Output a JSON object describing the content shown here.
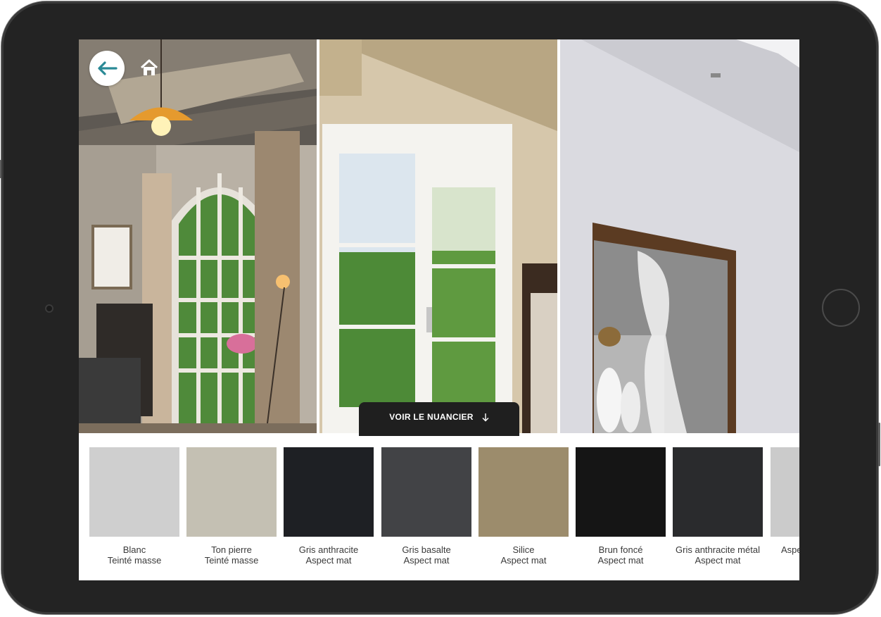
{
  "nav": {
    "back_icon": "arrow-left-icon",
    "home_icon": "home-icon",
    "accent": "#2a8a96"
  },
  "cta": {
    "label": "VOIR LE NUANCIER",
    "icon": "arrow-down-icon"
  },
  "swatches": [
    {
      "name": "Blanc",
      "finish": "Teinté masse",
      "color": "#cfcfcf"
    },
    {
      "name": "Ton pierre",
      "finish": "Teinté masse",
      "color": "#c4c0b3"
    },
    {
      "name": "Gris anthracite",
      "finish": "Aspect mat",
      "color": "#1e2024"
    },
    {
      "name": "Gris basalte",
      "finish": "Aspect mat",
      "color": "#424346"
    },
    {
      "name": "Silice",
      "finish": "Aspect mat",
      "color": "#9c8c6c"
    },
    {
      "name": "Brun foncé",
      "finish": "Aspect mat",
      "color": "#151515"
    },
    {
      "name": "Gris anthracite métal",
      "finish": "Aspect mat",
      "color": "#2a2b2d"
    },
    {
      "name": "",
      "finish": "Aspe",
      "color": "#cbcbcb"
    }
  ]
}
